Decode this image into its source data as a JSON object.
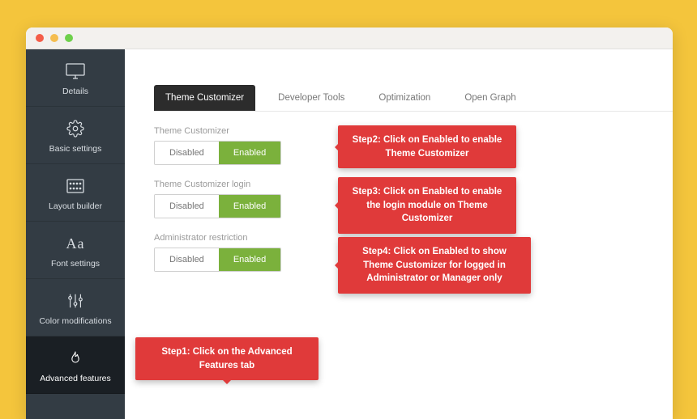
{
  "sidebar": {
    "items": [
      {
        "label": "Details"
      },
      {
        "label": "Basic settings"
      },
      {
        "label": "Layout builder"
      },
      {
        "label": "Font settings"
      },
      {
        "label": "Color modifications"
      },
      {
        "label": "Advanced features"
      }
    ]
  },
  "tabs": {
    "items": [
      {
        "label": "Theme Customizer"
      },
      {
        "label": "Developer Tools"
      },
      {
        "label": "Optimization"
      },
      {
        "label": "Open Graph"
      }
    ]
  },
  "fields": [
    {
      "label": "Theme Customizer",
      "disabled_label": "Disabled",
      "enabled_label": "Enabled"
    },
    {
      "label": "Theme Customizer login",
      "disabled_label": "Disabled",
      "enabled_label": "Enabled"
    },
    {
      "label": "Administrator restriction",
      "disabled_label": "Disabled",
      "enabled_label": "Enabled"
    }
  ],
  "callouts": {
    "step1": "Step1: Click on the Advanced Features tab",
    "step2": "Step2: Click on Enabled to enable Theme Customizer",
    "step3": "Step3: Click on Enabled to enable the login module on Theme Customizer",
    "step4": "Step4: Click on Enabled to show Theme Customizer for logged in Administrator or Manager only"
  }
}
